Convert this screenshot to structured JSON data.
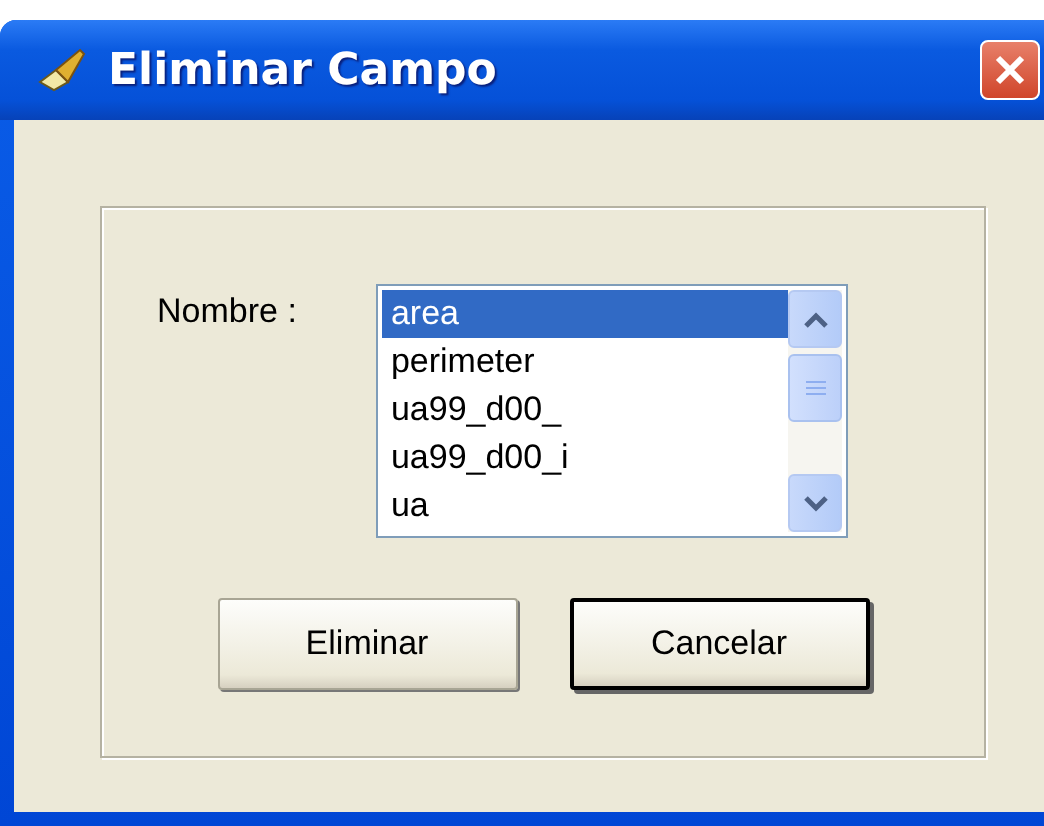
{
  "window": {
    "title": "Eliminar Campo"
  },
  "field_label": "Nombre :",
  "list_items": [
    {
      "label": "area",
      "selected": true
    },
    {
      "label": "perimeter",
      "selected": false
    },
    {
      "label": "ua99_d00_",
      "selected": false
    },
    {
      "label": "ua99_d00_i",
      "selected": false
    },
    {
      "label": "ua",
      "selected": false
    }
  ],
  "buttons": [
    {
      "label": "Eliminar",
      "default": false
    },
    {
      "label": "Cancelar",
      "default": true
    }
  ]
}
